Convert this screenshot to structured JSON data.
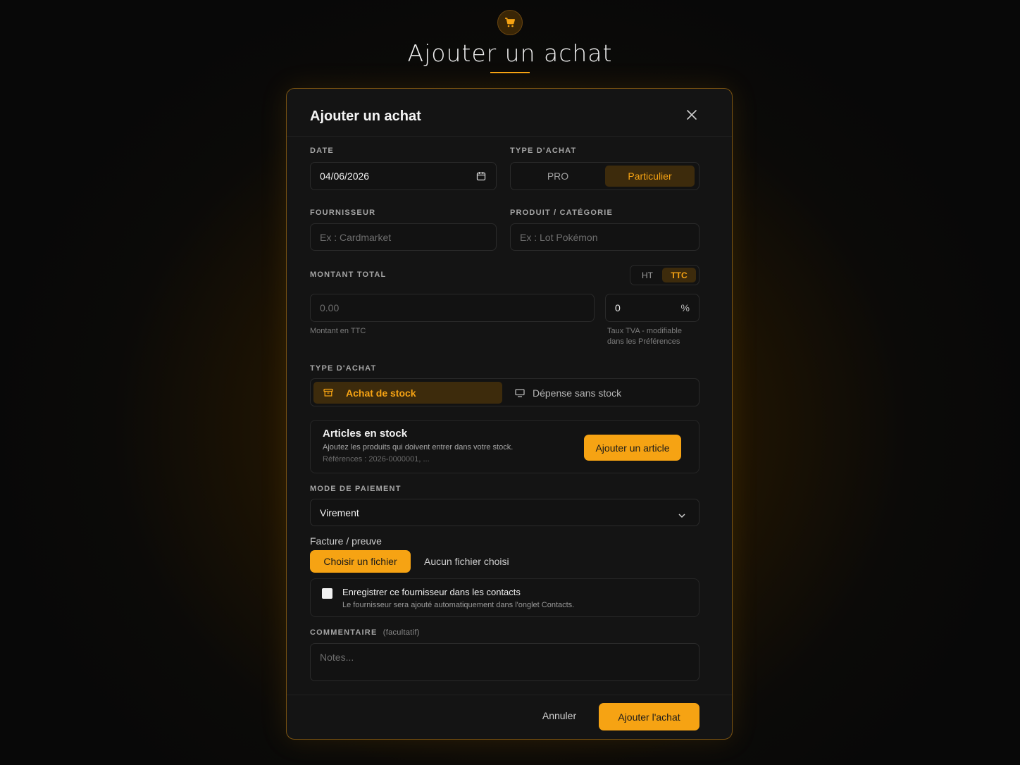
{
  "page": {
    "title": "Ajouter un achat",
    "icon": "shopping-cart-icon"
  },
  "modal": {
    "title": "Ajouter un achat",
    "close_icon": "close-icon"
  },
  "date": {
    "label": "DATE",
    "value": "04/06/2026",
    "icon": "calendar-icon"
  },
  "client_type": {
    "label": "TYPE D'ACHAT",
    "options": [
      "PRO",
      "Particulier"
    ],
    "selected": "Particulier"
  },
  "supplier": {
    "label": "FOURNISSEUR",
    "placeholder": "Ex : Cardmarket"
  },
  "product": {
    "label": "PRODUIT / CATÉGORIE",
    "placeholder": "Ex : Lot Pokémon"
  },
  "amount": {
    "label": "MONTANT TOTAL",
    "tax_modes": [
      "HT",
      "TTC"
    ],
    "selected_mode": "TTC",
    "placeholder": "0.00",
    "hint": "Montant en TTC",
    "vat_value": "0",
    "vat_unit": "%",
    "vat_hint_line1": "Taux TVA - modifiable",
    "vat_hint_line2": "dans les Préférences"
  },
  "purchase_kind": {
    "label": "TYPE D'ACHAT",
    "options": [
      {
        "label": "Achat de stock",
        "icon": "archive-box-icon"
      },
      {
        "label": "Dépense sans stock",
        "icon": "monitor-icon"
      }
    ],
    "selected": "Achat de stock"
  },
  "stock_articles": {
    "title": "Articles en stock",
    "description": "Ajoutez les produits qui doivent entrer dans votre stock.",
    "references": "Références : 2026-0000001, ...",
    "add_button": "Ajouter un article"
  },
  "payment": {
    "label": "MODE DE PAIEMENT",
    "selected": "Virement",
    "icon": "chevron-down-icon"
  },
  "invoice": {
    "label": "Facture / preuve",
    "button": "Choisir un fichier",
    "status": "Aucun fichier choisi"
  },
  "save_contact": {
    "label": "Enregistrer ce fournisseur dans les contacts",
    "hint": "Le fournisseur sera ajouté automatiquement dans l'onglet Contacts.",
    "checked": false
  },
  "comment": {
    "label": "COMMENTAIRE",
    "optional": "(facultatif)",
    "placeholder": "Notes..."
  },
  "footer": {
    "cancel": "Annuler",
    "submit": "Ajouter l'achat"
  },
  "colors": {
    "accent": "#f6a313",
    "background": "#0b0a08",
    "modal": "#141414"
  }
}
